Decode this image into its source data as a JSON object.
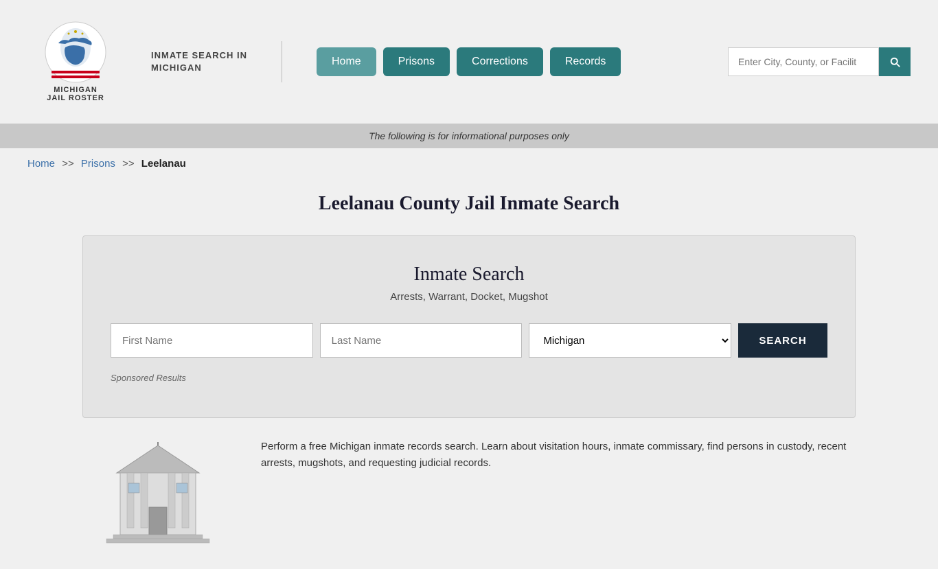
{
  "header": {
    "site_title_line1": "INMATE SEARCH IN",
    "site_title_line2": "MICHIGAN",
    "logo_text_line1": "MICHIGAN",
    "logo_text_line2": "JAIL ROSTER",
    "nav": {
      "home_label": "Home",
      "prisons_label": "Prisons",
      "corrections_label": "Corrections",
      "records_label": "Records"
    },
    "search_placeholder": "Enter City, County, or Facilit"
  },
  "info_bar": {
    "text": "The following is for informational purposes only"
  },
  "breadcrumb": {
    "home_label": "Home",
    "prisons_label": "Prisons",
    "current": "Leelanau",
    "sep": ">>"
  },
  "page_title": "Leelanau County Jail Inmate Search",
  "search_card": {
    "title": "Inmate Search",
    "subtitle": "Arrests, Warrant, Docket, Mugshot",
    "first_name_placeholder": "First Name",
    "last_name_placeholder": "Last Name",
    "state_default": "Michigan",
    "search_button_label": "SEARCH",
    "sponsored_label": "Sponsored Results"
  },
  "bottom_section": {
    "description": "Perform a free Michigan inmate records search. Learn about visitation hours, inmate commissary, find persons in custody, recent arrests, mugshots, and requesting judicial records."
  }
}
